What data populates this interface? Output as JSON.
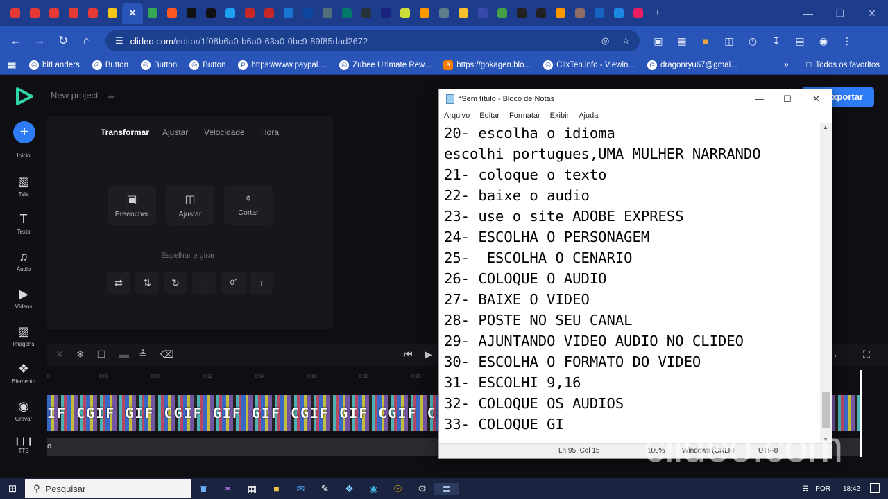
{
  "browser": {
    "url_host": "clideo.com",
    "url_path": "/editor/1f08b6a0-b6a0-63a0-0bc9-89f85dad2672",
    "tab_colors": [
      "#e53935",
      "#e53935",
      "#e53935",
      "#e53935",
      "#e53935",
      "#f5c518",
      "#34a853",
      "#ff5722",
      "#111111",
      "#111111",
      "#1da1f2",
      "#c62828",
      "#c62828",
      "#1976d2",
      "#0d47a1",
      "#546e7a",
      "#00796b",
      "#263238",
      "#1a237e",
      "#cddc39",
      "#ff9800",
      "#607d8b",
      "#fbc02d",
      "#3949ab",
      "#43a047",
      "#212121",
      "#212121",
      "#ff9800",
      "#8d6e63",
      "#1565c0",
      "#1e88e5",
      "#e91e63"
    ],
    "bookmarks": [
      {
        "icon": "globe-icon",
        "label": "bitLanders"
      },
      {
        "icon": "globe-icon",
        "label": "Button"
      },
      {
        "icon": "globe-icon",
        "label": "Button"
      },
      {
        "icon": "globe-icon",
        "label": "Button"
      },
      {
        "icon": "paypal-icon",
        "label": "https://www.paypal...."
      },
      {
        "icon": "globe-icon",
        "label": "Zubee Ultimate Rew..."
      },
      {
        "icon": "blogger-icon",
        "label": "https://gokagen.blo..."
      },
      {
        "icon": "globe-icon",
        "label": "ClixTen.info - Viewin..."
      },
      {
        "icon": "google-icon",
        "label": "dragonryu67@gmai..."
      }
    ],
    "all_bookmarks": "Todos os favoritos"
  },
  "editor": {
    "project_name": "New project",
    "export_label": "xportar",
    "sidebar": [
      {
        "icon": "tela-icon",
        "label": "Tela"
      },
      {
        "icon": "text-icon",
        "label": "Texto"
      },
      {
        "icon": "music-icon",
        "label": "Áudio"
      },
      {
        "icon": "video-icon",
        "label": "Vídeos"
      },
      {
        "icon": "image-icon",
        "label": "Imagens"
      },
      {
        "icon": "shapes-icon",
        "label": "Elemento"
      },
      {
        "icon": "record-icon",
        "label": "Gravar"
      },
      {
        "icon": "tts-icon",
        "label": "TTS"
      }
    ],
    "sidebar_top_label": "Início",
    "tabs": [
      "Transformar",
      "Ajustar",
      "Velocidade",
      "Hora"
    ],
    "tools": [
      "Preencher",
      "Ajustar",
      "Cortar"
    ],
    "mirror_label": "Espelhar e girar",
    "rotation_value": "0°",
    "ruler_ticks": [
      "0",
      "0:08",
      "0:08",
      "0:12",
      "0:14",
      "0:16",
      "0:18",
      "0:20"
    ],
    "track_text": "IF CGIF GIF CGIF GIF GIF CGIF GIF CGIF CGIF GIF C",
    "audio_label": "o"
  },
  "notepad": {
    "title": "*Sem título - Bloco de Notas",
    "menu": [
      "Arquivo",
      "Editar",
      "Formatar",
      "Exibir",
      "Ajuda"
    ],
    "lines": [
      "20- escolha o idioma",
      "escolhi portugues,UMA MULHER NARRANDO",
      "21- coloque o texto",
      "22- baixe o audio",
      "23- use o site ADOBE EXPRESS",
      "24- ESCOLHA O PERSONAGEM",
      "25-  ESCOLHA O CENARIO",
      "26- COLOQUE O AUDIO",
      "27- BAIXE O VIDEO",
      "28- POSTE NO SEU CANAL",
      "29- AJUNTANDO VIDEO AUDIO NO CLIDEO",
      "30- ESCOLHA O FORMATO DO VIDEO",
      "31- ESCOLHI 9,16",
      "32- COLOQUE OS AUDIOS",
      "33- COLOQUE GI"
    ],
    "status_position": "Ln 95, Col 15",
    "status_zoom": "100%",
    "status_eol": "Windows (CRLF)",
    "status_encoding": "UTF-8"
  },
  "watermark": "clideo.com",
  "taskbar": {
    "search_placeholder": "Pesquisar",
    "language": "POR",
    "time": "18:42"
  }
}
